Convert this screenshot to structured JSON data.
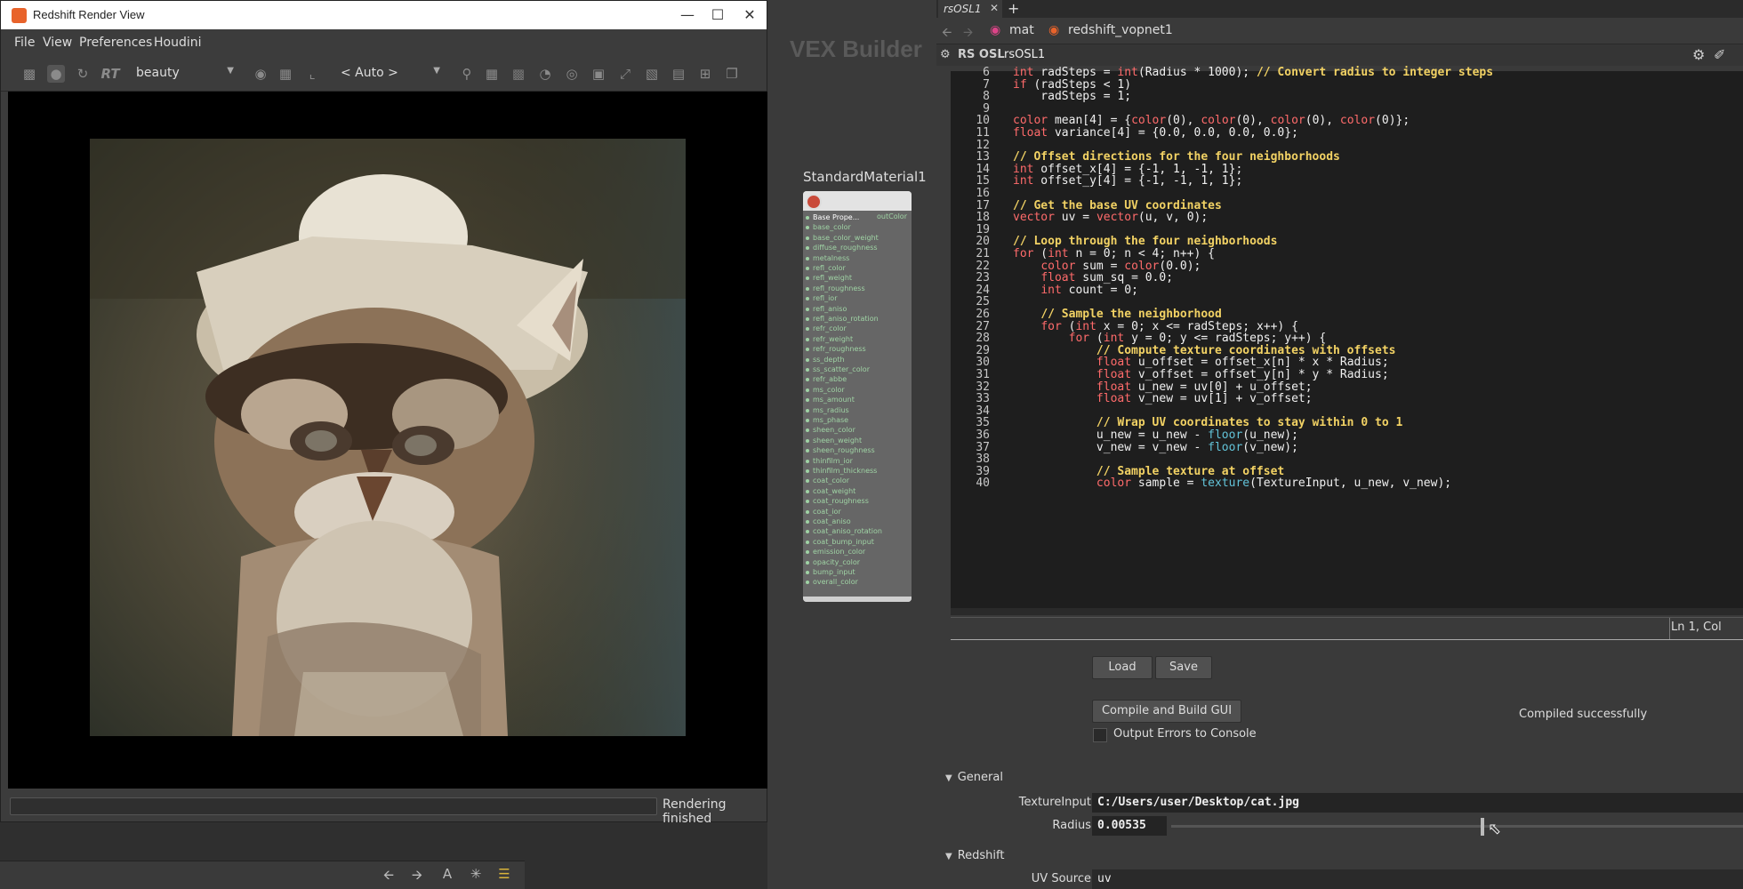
{
  "render_view": {
    "title": "Redshift Render View",
    "menus": [
      "File",
      "View",
      "Preferences",
      "Houdini"
    ],
    "toolbar": {
      "rt_label": "RT",
      "aov_value": "beauty",
      "camera_value": "< Auto >"
    },
    "status": "Rendering finished"
  },
  "network": {
    "context_label": "VEX Builder",
    "node_name": "StandardMaterial1",
    "node_output": "outColor",
    "node_ports": [
      "Base Prope...",
      "base_color",
      "base_color_weight",
      "diffuse_roughness",
      "metalness",
      "refl_color",
      "refl_weight",
      "refl_roughness",
      "refl_ior",
      "refl_aniso",
      "refl_aniso_rotation",
      "refr_color",
      "refr_weight",
      "refr_roughness",
      "ss_depth",
      "ss_scatter_color",
      "refr_abbe",
      "ms_color",
      "ms_amount",
      "ms_radius",
      "ms_phase",
      "sheen_color",
      "sheen_weight",
      "sheen_roughness",
      "thinfilm_ior",
      "thinfilm_thickness",
      "coat_color",
      "coat_weight",
      "coat_roughness",
      "coat_ior",
      "coat_aniso",
      "coat_aniso_rotation",
      "coat_bump_input",
      "emission_color",
      "opacity_color",
      "bump_input",
      "overall_color"
    ]
  },
  "params": {
    "tab_label": "rsOSL1",
    "breadcrumbs": [
      "mat",
      "redshift_vopnet1"
    ],
    "node_type": "RS OSL",
    "node_name": "rsOSL1",
    "code_lines": [
      {
        "n": "6",
        "text": "int radSteps = int(Radius * 1000); // Convert radius to integer steps"
      },
      {
        "n": "7",
        "text": "if (radSteps < 1)"
      },
      {
        "n": "8",
        "text": "    radSteps = 1;"
      },
      {
        "n": "9",
        "text": ""
      },
      {
        "n": "10",
        "text": "color mean[4] = {color(0), color(0), color(0), color(0)};"
      },
      {
        "n": "11",
        "text": "float variance[4] = {0.0, 0.0, 0.0, 0.0};"
      },
      {
        "n": "12",
        "text": ""
      },
      {
        "n": "13",
        "text": "// Offset directions for the four neighborhoods"
      },
      {
        "n": "14",
        "text": "int offset_x[4] = {-1, 1, -1, 1};"
      },
      {
        "n": "15",
        "text": "int offset_y[4] = {-1, -1, 1, 1};"
      },
      {
        "n": "16",
        "text": ""
      },
      {
        "n": "17",
        "text": "// Get the base UV coordinates"
      },
      {
        "n": "18",
        "text": "vector uv = vector(u, v, 0);"
      },
      {
        "n": "19",
        "text": ""
      },
      {
        "n": "20",
        "text": "// Loop through the four neighborhoods"
      },
      {
        "n": "21",
        "text": "for (int n = 0; n < 4; n++) {"
      },
      {
        "n": "22",
        "text": "    color sum = color(0.0);"
      },
      {
        "n": "23",
        "text": "    float sum_sq = 0.0;"
      },
      {
        "n": "24",
        "text": "    int count = 0;"
      },
      {
        "n": "25",
        "text": ""
      },
      {
        "n": "26",
        "text": "    // Sample the neighborhood"
      },
      {
        "n": "27",
        "text": "    for (int x = 0; x <= radSteps; x++) {"
      },
      {
        "n": "28",
        "text": "        for (int y = 0; y <= radSteps; y++) {"
      },
      {
        "n": "29",
        "text": "            // Compute texture coordinates with offsets"
      },
      {
        "n": "30",
        "text": "            float u_offset = offset_x[n] * x * Radius;"
      },
      {
        "n": "31",
        "text": "            float v_offset = offset_y[n] * y * Radius;"
      },
      {
        "n": "32",
        "text": "            float u_new = uv[0] + u_offset;"
      },
      {
        "n": "33",
        "text": "            float v_new = uv[1] + v_offset;"
      },
      {
        "n": "34",
        "text": ""
      },
      {
        "n": "35",
        "text": "            // Wrap UV coordinates to stay within 0 to 1"
      },
      {
        "n": "36",
        "text": "            u_new = u_new - floor(u_new);"
      },
      {
        "n": "37",
        "text": "            v_new = v_new - floor(v_new);"
      },
      {
        "n": "38",
        "text": ""
      },
      {
        "n": "39",
        "text": "            // Sample texture at offset"
      },
      {
        "n": "40",
        "text": "            color sample = texture(TextureInput, u_new, v_new);"
      }
    ],
    "editor_status": "Ln 1, Col",
    "load_label": "Load",
    "save_label": "Save",
    "compile_label": "Compile and Build GUI",
    "compile_status": "Compiled successfully",
    "output_errors_label": "Output Errors to Console",
    "section_general": "General",
    "texture_input_label": "TextureInput",
    "texture_input_value": "C:/Users/user/Desktop/cat.jpg",
    "radius_label": "Radius",
    "radius_value": "0.00535",
    "section_redshift": "Redshift",
    "uv_source_label": "UV Source",
    "uv_source_value": "uv"
  }
}
